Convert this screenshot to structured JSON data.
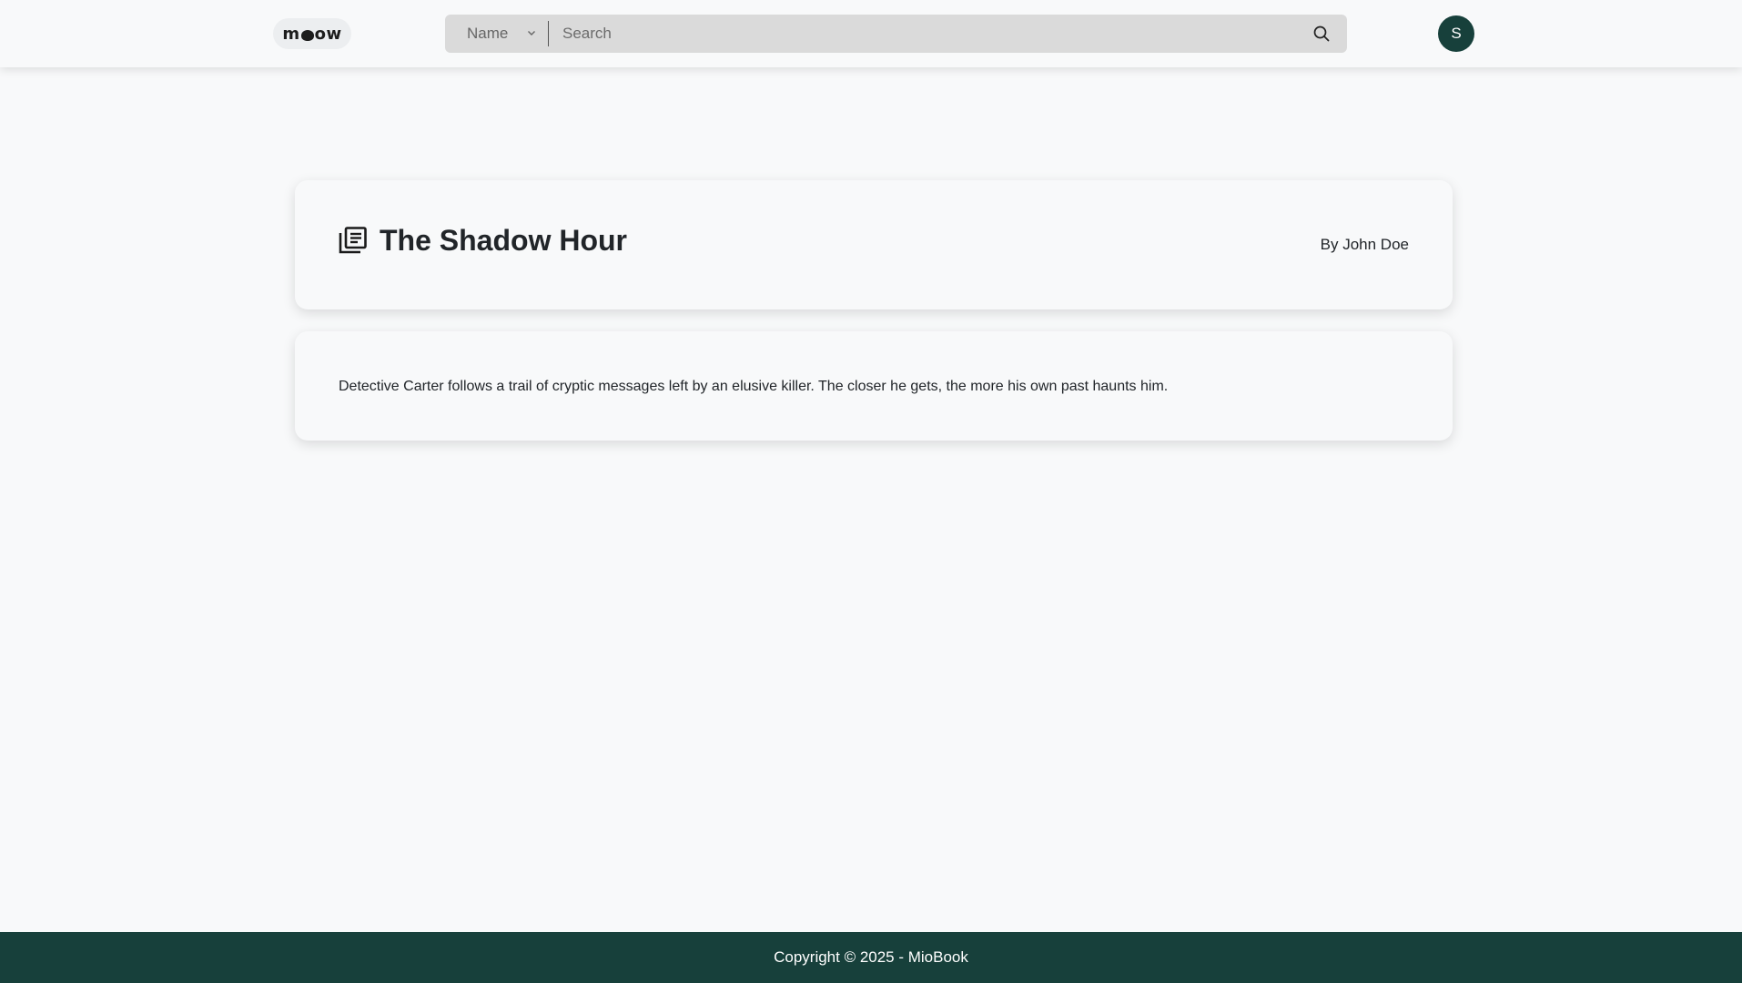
{
  "header": {
    "logo_text": "meow",
    "search": {
      "selected_filter": "Name",
      "placeholder": "Search",
      "value": ""
    },
    "avatar_initial": "S"
  },
  "book": {
    "title": "The Shadow Hour",
    "author": "By John Doe",
    "description": "Detective Carter follows a trail of cryptic messages left by an elusive killer. The closer he gets, the more his own past haunts him."
  },
  "footer": {
    "copyright": "Copyright © 2025 - MioBook"
  },
  "colors": {
    "brand_dark_green": "#17403b",
    "page_background": "#f8f9fa",
    "search_background": "#dadada"
  },
  "icons": {
    "book": "library-books-icon",
    "search": "search-icon",
    "dropdown": "chevron-down-icon"
  }
}
